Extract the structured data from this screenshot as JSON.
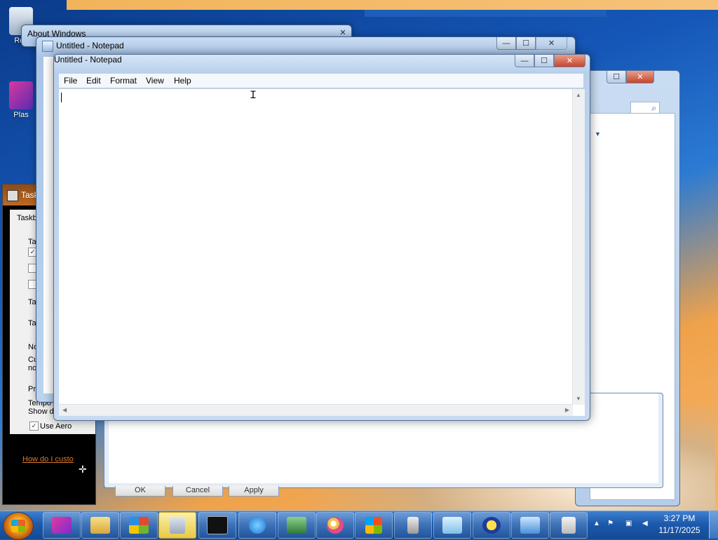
{
  "desktop": {
    "icons": [
      {
        "label": "Rec"
      },
      {
        "label": "Plas"
      }
    ]
  },
  "about_window": {
    "title": "About Windows"
  },
  "notepad_back": {
    "title": "Untitled - Notepad"
  },
  "notepad": {
    "title": "Untitled - Notepad",
    "menu": [
      "File",
      "Edit",
      "Format",
      "View",
      "Help"
    ],
    "content": ""
  },
  "taskbar_props": {
    "title": "Task",
    "tab": "Taskb",
    "lines": [
      "Ta",
      "Ta",
      "Ta",
      "No",
      "Cu",
      "no",
      "Pre",
      "Tempo",
      "Show d"
    ],
    "use_aero": "Use Aero",
    "help_link": "How do I custo"
  },
  "dialog_buttons": [
    "OK",
    "Cancel",
    "Apply"
  ],
  "explorer": {},
  "caption_buttons": {
    "minimize": "—",
    "maximize": "☐",
    "close": "✕"
  },
  "clock": {
    "time": "3:27 PM",
    "date": "11/17/2025"
  },
  "colors": {
    "taskbar": "#1d5aac",
    "desktop_accent": "#f0a24a",
    "close_button": "#c8442b"
  }
}
